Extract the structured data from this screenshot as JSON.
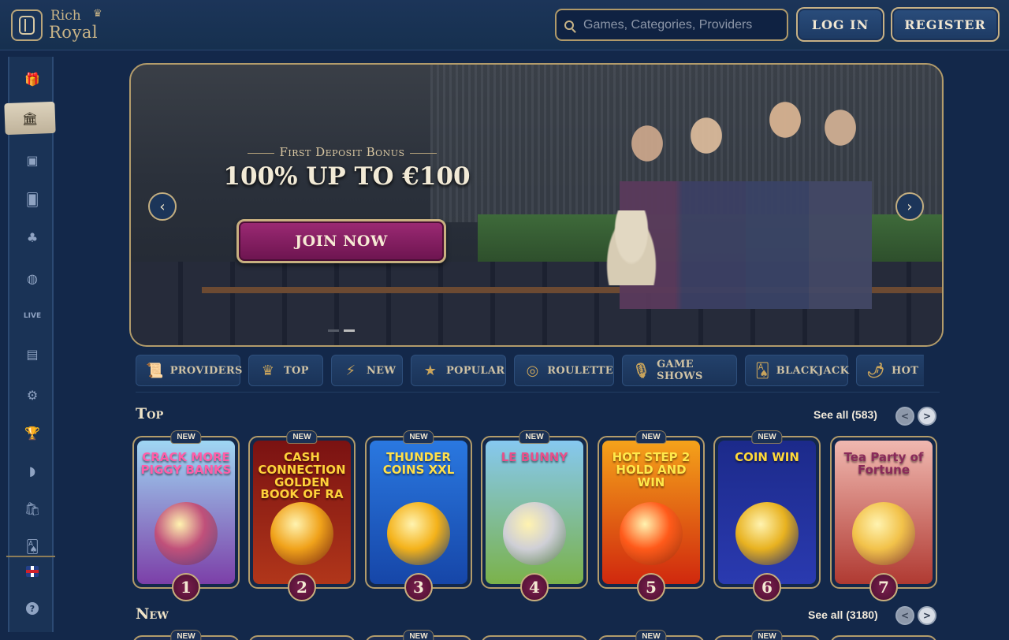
{
  "header": {
    "logo_line1": "Rich",
    "logo_crown": "♛",
    "logo_line2": "Royal",
    "search_placeholder": "Games, Categories, Providers",
    "login_label": "LOG IN",
    "register_label": "REGISTER"
  },
  "sidebar": {
    "items": [
      {
        "name": "gift-icon",
        "glyph": "🎁"
      },
      {
        "name": "bank-icon",
        "glyph": "🏛"
      },
      {
        "name": "slot-machine-icon",
        "glyph": "▣"
      },
      {
        "name": "cards-icon",
        "glyph": "🂠"
      },
      {
        "name": "clover-icon",
        "glyph": "♣"
      },
      {
        "name": "basketball-icon",
        "glyph": "◍"
      },
      {
        "name": "live-icon",
        "glyph": "LIVE"
      },
      {
        "name": "tv-icon",
        "glyph": "▤"
      },
      {
        "name": "gear-icon",
        "glyph": "⚙"
      },
      {
        "name": "trophy-icon",
        "glyph": "🏆"
      },
      {
        "name": "boomerang-icon",
        "glyph": "◗"
      },
      {
        "name": "shop-bag-icon",
        "glyph": "🛍"
      },
      {
        "name": "cards-stack-icon",
        "glyph": "🂡"
      }
    ],
    "help_label": "?"
  },
  "banner": {
    "subtitle": "First Deposit Bonus",
    "title": "100% UP TO €100",
    "cta_label": "JOIN NOW",
    "prev_arrow": "‹",
    "next_arrow": "›",
    "slide_count": 2,
    "active_slide": 2
  },
  "categories": [
    {
      "label": "PROVIDERS",
      "icon": "📜"
    },
    {
      "label": "TOP",
      "icon": "♛"
    },
    {
      "label": "NEW",
      "icon": "⚡"
    },
    {
      "label": "POPULAR",
      "icon": "★"
    },
    {
      "label": "ROULETTE",
      "icon": "◎"
    },
    {
      "label": "GAME SHOWS",
      "icon": "🎙"
    },
    {
      "label": "BLACKJACK",
      "icon": "🂡"
    },
    {
      "label": "HOT",
      "icon": "🌶"
    }
  ],
  "sections": {
    "top": {
      "title": "Top",
      "see_all": "See all (583)",
      "prev": "<",
      "next": ">"
    },
    "new": {
      "title": "New",
      "see_all": "See all (3180)",
      "prev": "<",
      "next": ">"
    }
  },
  "top_games": [
    {
      "title": "CRACK MORE PIGGY BANKS",
      "rank": "1",
      "badge": "NEW",
      "color_top": "#9fd6f3",
      "color_bottom": "#7c3fa8",
      "title_color": "#ff5ea8",
      "orb": "#c0507a"
    },
    {
      "title": "CASH CONNECTION GOLDEN BOOK OF RA",
      "rank": "2",
      "badge": "NEW",
      "color_top": "#7a1212",
      "color_bottom": "#b1361a",
      "title_color": "#ffd23a",
      "orb": "#f0a21a"
    },
    {
      "title": "THUNDER COINS XXL",
      "rank": "3",
      "badge": "NEW",
      "color_top": "#2a78e0",
      "color_bottom": "#1646a8",
      "title_color": "#ffe04a",
      "orb": "#f4b21a"
    },
    {
      "title": "LE BUNNY",
      "rank": "4",
      "badge": "NEW",
      "color_top": "#86c8f0",
      "color_bottom": "#7bb24a",
      "title_color": "#e8508a",
      "orb": "#cfcfd6"
    },
    {
      "title": "HOT STEP 2 HOLD AND WIN",
      "rank": "5",
      "badge": "NEW",
      "color_top": "#f4a21a",
      "color_bottom": "#d0280e",
      "title_color": "#ffe84a",
      "orb": "#ff5a1a"
    },
    {
      "title": "COIN WIN",
      "rank": "6",
      "badge": "NEW",
      "color_top": "#1c2a8a",
      "color_bottom": "#2a3ab0",
      "title_color": "#ffd93a",
      "orb": "#e8b220"
    },
    {
      "title": "Tea Party of Fortune",
      "rank": "7",
      "badge": "",
      "color_top": "#f0b8b0",
      "color_bottom": "#b03a32",
      "title_color": "#8a2a5a",
      "orb": "#f2c24a"
    }
  ],
  "new_games": [
    {
      "badge": "NEW"
    },
    {
      "badge": ""
    },
    {
      "badge": "NEW"
    },
    {
      "badge": ""
    },
    {
      "badge": "NEW"
    },
    {
      "badge": "NEW"
    },
    {
      "badge": ""
    }
  ]
}
